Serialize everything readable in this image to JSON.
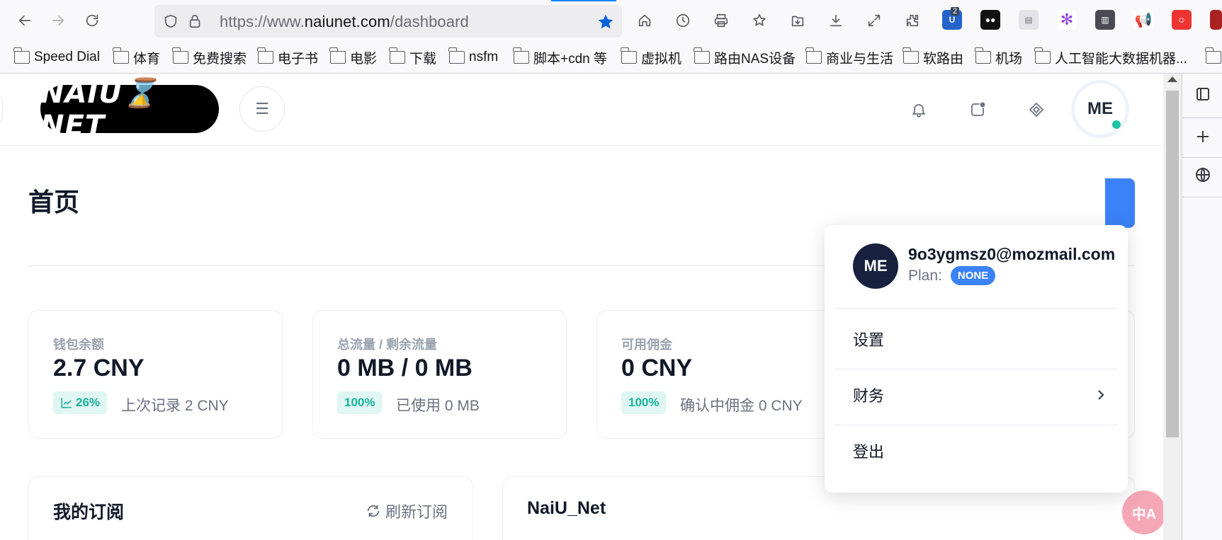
{
  "browser": {
    "url_prefix": "https://www.",
    "url_domain": "naiunet.com",
    "url_path": "/dashboard",
    "extension_badge": "2",
    "bookmarks": [
      "Speed Dial",
      "体育",
      "免费搜索",
      "电子书",
      "电影",
      "下载",
      "nsfm",
      "脚本+cdn 等",
      "虚拟机",
      "路由NAS设备",
      "商业与生活",
      "软路由",
      "机场",
      "人工智能大数据机器..."
    ]
  },
  "header": {
    "logo_text": "NAIU⌛NET",
    "avatar_initials": "ME"
  },
  "page": {
    "title": "首页"
  },
  "cards": [
    {
      "label": "钱包余额",
      "value": "2.7 CNY",
      "badge": "26%",
      "sub": "上次记录 2 CNY"
    },
    {
      "label": "总流量 / 剩余流量",
      "value": "0 MB / 0 MB",
      "badge": "100%",
      "sub": "已使用 0 MB"
    },
    {
      "label": "可用佣金",
      "value": "0 CNY",
      "badge": "100%",
      "sub": "确认中佣金 0 CNY"
    }
  ],
  "panels": {
    "subscription_title": "我的订阅",
    "refresh_label": "刷新订阅",
    "announcement_title": "NaiU_Net"
  },
  "dropdown": {
    "avatar_initials": "ME",
    "email": "9o3ygmsz0@mozmail.com",
    "plan_label": "Plan:",
    "plan_value": "NONE",
    "items": [
      "设置",
      "财务",
      "登出"
    ]
  },
  "colors": {
    "accent": "#3b82f6",
    "success": "#17b49a",
    "online_dot": "#1bc5a1",
    "dropdown_avatar_bg": "#17213d"
  }
}
